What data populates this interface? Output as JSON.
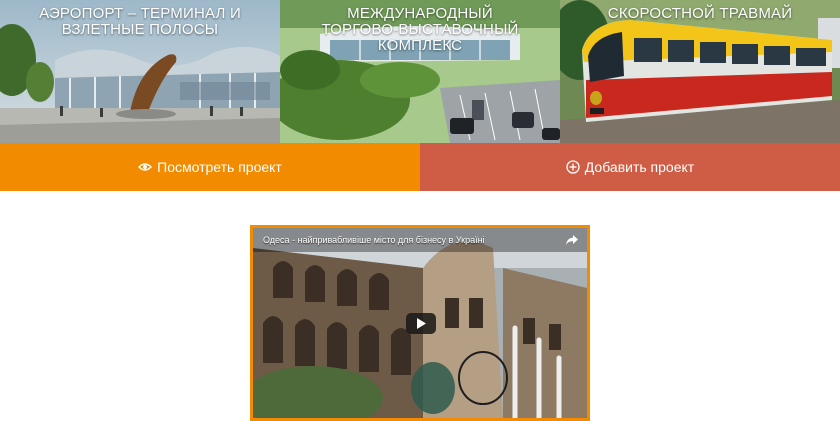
{
  "projects": [
    {
      "title": "АЭРОПОРТ – ТЕРМИНАЛ И\nВЗЛЕТНЫЕ ПОЛОСЫ"
    },
    {
      "title": "МЕЖДУНАРОДНЫЙ\nТОРГОВО-ВЫСТАВОЧНЫЙ\nКОМПЛЕКС"
    },
    {
      "title": "СКОРОСТНОЙ ТРАВМАЙ"
    }
  ],
  "actions": {
    "view_label": "Посмотреть проект",
    "add_label": "Добавить проект"
  },
  "video": {
    "title": "Одеса - найпривабливіше місто для бізнесу в Україні"
  },
  "colors": {
    "view_bar": "#f28b00",
    "add_bar": "#cf5d46",
    "video_border": "#f28b00"
  },
  "icons": {
    "view": "eye-icon",
    "add": "plus-circle-icon",
    "share": "share-icon",
    "play": "play-icon"
  }
}
